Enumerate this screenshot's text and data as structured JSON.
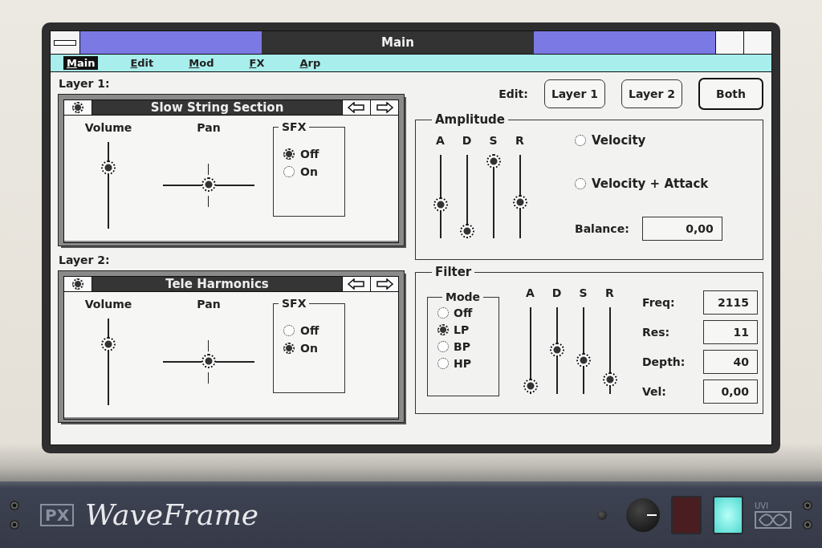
{
  "window": {
    "title": "Main"
  },
  "menu": [
    {
      "label": "Main",
      "selected": true
    },
    {
      "label": "Edit",
      "selected": false
    },
    {
      "label": "Mod",
      "selected": false
    },
    {
      "label": "FX",
      "selected": false
    },
    {
      "label": "Arp",
      "selected": false
    }
  ],
  "layers": [
    {
      "heading": "Layer 1:",
      "patch": "Slow String Section",
      "volume_label": "Volume",
      "volume": {
        "level": 0.7
      },
      "pan_label": "Pan",
      "pan": {
        "level": 0.5
      },
      "sfx": {
        "title": "SFX",
        "options": [
          {
            "label": "Off",
            "selected": true
          },
          {
            "label": "On",
            "selected": false
          }
        ]
      }
    },
    {
      "heading": "Layer 2:",
      "patch": "Tele Harmonics",
      "volume_label": "Volume",
      "volume": {
        "level": 0.7
      },
      "pan_label": "Pan",
      "pan": {
        "level": 0.5
      },
      "sfx": {
        "title": "SFX",
        "options": [
          {
            "label": "Off",
            "selected": false
          },
          {
            "label": "On",
            "selected": true
          }
        ]
      }
    }
  ],
  "edit": {
    "label": "Edit:",
    "buttons": [
      {
        "label": "Layer 1",
        "selected": false
      },
      {
        "label": "Layer 2",
        "selected": false
      },
      {
        "label": "Both",
        "selected": true
      }
    ]
  },
  "amplitude": {
    "title": "Amplitude",
    "envelope": [
      {
        "label": "A",
        "level": 0.4
      },
      {
        "label": "D",
        "level": 0.09
      },
      {
        "label": "S",
        "level": 0.92
      },
      {
        "label": "R",
        "level": 0.43
      }
    ],
    "options": [
      {
        "label": "Velocity",
        "selected": false
      },
      {
        "label": "Velocity + Attack",
        "selected": false
      }
    ],
    "balance": {
      "label": "Balance:",
      "value": "0,00"
    }
  },
  "filter": {
    "title": "Filter",
    "mode": {
      "title": "Mode",
      "options": [
        {
          "label": "Off",
          "selected": false
        },
        {
          "label": "LP",
          "selected": true
        },
        {
          "label": "BP",
          "selected": false
        },
        {
          "label": "HP",
          "selected": false
        }
      ]
    },
    "envelope": [
      {
        "label": "A",
        "level": 0.09
      },
      {
        "label": "D",
        "level": 0.51
      },
      {
        "label": "S",
        "level": 0.39
      },
      {
        "label": "R",
        "level": 0.17
      }
    ],
    "params": [
      {
        "label": "Freq:",
        "value": "2115"
      },
      {
        "label": "Res:",
        "value": "11"
      },
      {
        "label": "Depth:",
        "value": "40"
      },
      {
        "label": "Vel:",
        "value": "0,00"
      }
    ]
  },
  "footer": {
    "logo": "PX",
    "product": "WaveFrame",
    "brand": "UVI"
  }
}
